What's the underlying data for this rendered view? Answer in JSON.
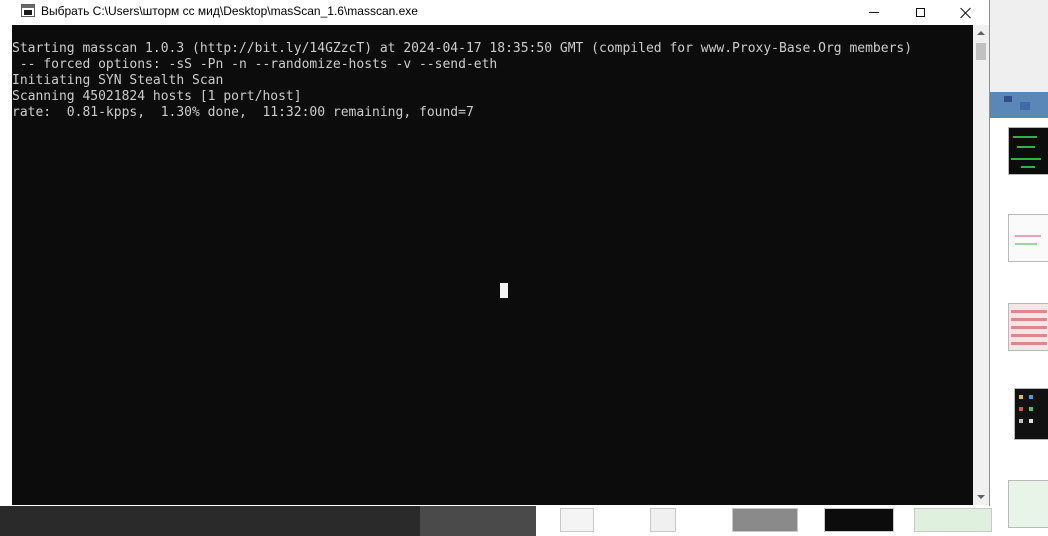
{
  "window": {
    "title": "Выбрать C:\\Users\\шторм сс мид\\Desktop\\masScan_1.6\\masscan.exe",
    "app_icon": "console-icon",
    "controls": {
      "minimize_icon": "minimize-icon",
      "maximize_icon": "maximize-icon",
      "close_icon": "close-icon"
    }
  },
  "console": {
    "background": "#0c0c0c",
    "foreground": "#cccccc",
    "lines": [
      "",
      "Starting masscan 1.0.3 (http://bit.ly/14GZzcT) at 2024-04-17 18:35:50 GMT (compiled for www.Proxy-Base.Org members)",
      " -- forced options: -sS -Pn -n --randomize-hosts -v --send-eth",
      "Initiating SYN Stealth Scan",
      "Scanning 45021824 hosts [1 port/host]",
      "rate:  0.81-kpps,  1.30% done,  11:32:00 remaining, found=7"
    ]
  }
}
